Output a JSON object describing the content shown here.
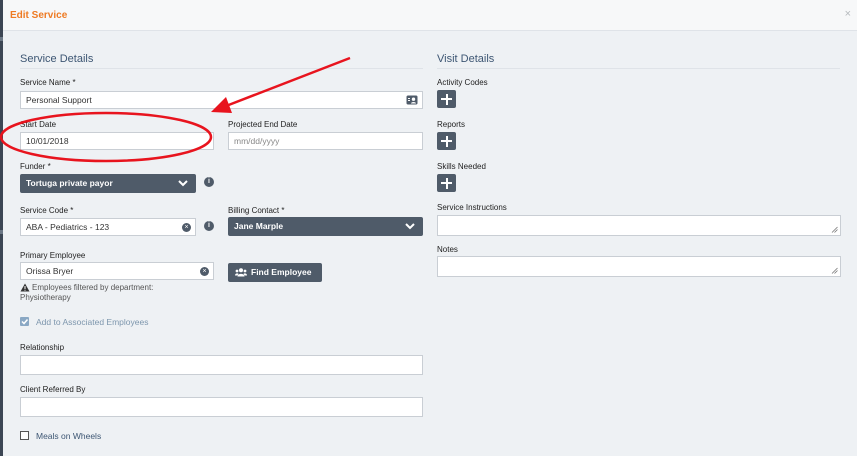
{
  "dialog": {
    "title": "Edit Service",
    "close_glyph": "×"
  },
  "service_details": {
    "heading": "Service Details",
    "service_name": {
      "label": "Service Name *",
      "value": "Personal Support"
    },
    "start_date": {
      "label": "Start Date",
      "value": "10/01/2018"
    },
    "projected_end_date": {
      "label": "Projected End Date",
      "placeholder": "mm/dd/yyyy"
    },
    "funder": {
      "label": "Funder *",
      "value": "Tortuga private payor"
    },
    "service_code": {
      "label": "Service Code *",
      "value": "ABA - Pediatrics - 123"
    },
    "billing_contact": {
      "label": "Billing Contact *",
      "value": "Jane Marple"
    },
    "primary_employee": {
      "label": "Primary Employee",
      "value": "Orissa Bryer",
      "find_button": "Find Employee",
      "filter_note_line1": "Employees filtered by department:",
      "filter_note_line2": "Physiotherapy"
    },
    "add_to_associated": {
      "label": "Add to Associated Employees",
      "checked": true
    },
    "relationship": {
      "label": "Relationship",
      "value": ""
    },
    "client_referred_by": {
      "label": "Client Referred By",
      "value": ""
    },
    "meals_on_wheels": {
      "label": "Meals on Wheels",
      "checked": false
    }
  },
  "visit_details": {
    "heading": "Visit Details",
    "activity_codes": {
      "label": "Activity Codes"
    },
    "reports": {
      "label": "Reports"
    },
    "skills_needed": {
      "label": "Skills Needed"
    },
    "service_instructions": {
      "label": "Service Instructions",
      "value": ""
    },
    "notes": {
      "label": "Notes",
      "value": ""
    }
  },
  "colors": {
    "title_orange": "#ee7a23",
    "section_blue": "#3d5673",
    "dark_control": "#4f5b69",
    "annotation_red": "#e8141e"
  },
  "icons": [
    "close-icon",
    "contact-card-icon",
    "chevron-down-icon",
    "info-icon",
    "clear-icon",
    "plus-icon",
    "users-icon",
    "warning-icon",
    "checkbox-icon",
    "resize-grip-icon"
  ]
}
